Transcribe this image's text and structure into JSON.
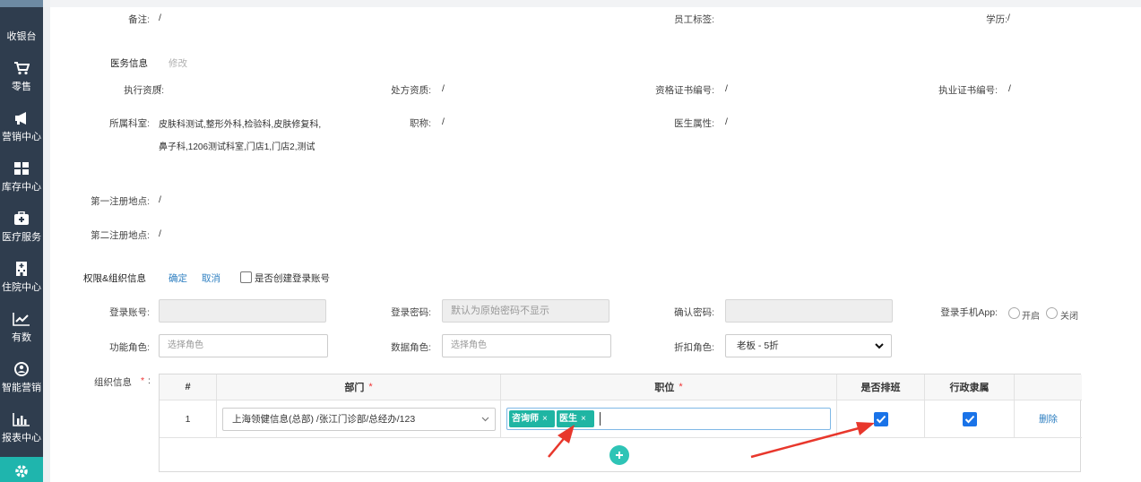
{
  "sidebar": {
    "items": [
      {
        "label": "收银台",
        "icon": "cashier-icon"
      },
      {
        "label": "零售",
        "icon": "cart-icon"
      },
      {
        "label": "营销中心",
        "icon": "megaphone-icon"
      },
      {
        "label": "库存中心",
        "icon": "grid-icon"
      },
      {
        "label": "医疗服务",
        "icon": "medical-kit-icon"
      },
      {
        "label": "住院中心",
        "icon": "hospital-icon"
      },
      {
        "label": "有数",
        "icon": "trend-chart-icon"
      },
      {
        "label": "智能营销",
        "icon": "smart-marketing-icon"
      },
      {
        "label": "报表中心",
        "icon": "bar-chart-icon"
      },
      {
        "label": "",
        "icon": "gear-icon"
      }
    ],
    "active_color": "#1fb5ad"
  },
  "basic": {
    "remark_label": "备注:",
    "remark_value": "/",
    "tag_label": "员工标签:",
    "edu_label": "学历:",
    "edu_value": "/"
  },
  "medical": {
    "section_title": "医务信息",
    "edit_label": "修改",
    "exec_label": "执行资质:",
    "exec_value": "/",
    "rx_label": "处方资质:",
    "rx_value": "/",
    "cert_label": "资格证书编号:",
    "cert_value": "/",
    "license_label": "执业证书编号:",
    "license_value": "/",
    "dept_label": "所属科室:",
    "dept_value": "皮肤科测试,整形外科,检验科,皮肤修复科,鼻子科,1206测试科室,门店1,门店2,测试",
    "title_label": "职称:",
    "title_value": "/",
    "attr_label": "医生属性:",
    "attr_value": "/",
    "reg1_label": "第一注册地点:",
    "reg1_value": "/",
    "reg2_label": "第二注册地点:",
    "reg2_value": "/"
  },
  "perm": {
    "section_title": "权限&组织信息",
    "confirm_label": "确定",
    "cancel_label": "取消",
    "create_account_label": "是否创建登录账号",
    "account_label": "登录账号:",
    "password_label": "登录密码:",
    "password_placeholder": "默认为原始密码不显示",
    "confirm_pwd_label": "确认密码:",
    "app_label": "登录手机App:",
    "app_on": "开启",
    "app_off": "关闭",
    "func_role_label": "功能角色:",
    "func_role_placeholder": "选择角色",
    "data_role_label": "数据角色:",
    "data_role_placeholder": "选择角色",
    "discount_label": "折扣角色:",
    "discount_value": "老板 - 5折",
    "org_label": "组织信息",
    "org_req": "*",
    "org_colon": ":"
  },
  "table": {
    "headers": {
      "index": "#",
      "dept": "部门",
      "position": "职位",
      "schedule": "是否排班",
      "admin": "行政隶属"
    },
    "required_mark": "*",
    "rows": [
      {
        "index": "1",
        "dept": "上海领健信息(总部) /张江门诊部/总经办/123",
        "tags": [
          "咨询师",
          "医生"
        ],
        "tag_remove": "×",
        "schedule": true,
        "admin": true,
        "delete_label": "删除"
      }
    ]
  },
  "colors": {
    "accent": "#1fb5ad",
    "link": "#2e7fc1",
    "arrow": "#e8372c",
    "checkbox": "#1a73e8"
  }
}
